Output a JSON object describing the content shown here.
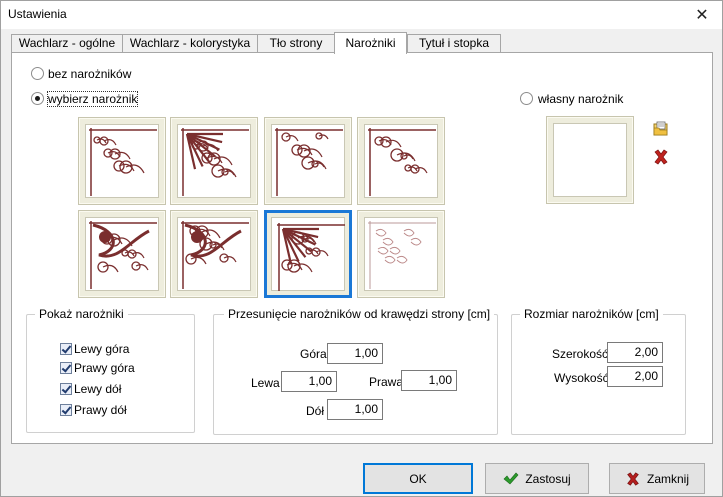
{
  "window": {
    "title": "Ustawienia"
  },
  "tabs": [
    {
      "label": "Wachlarz - ogólne"
    },
    {
      "label": "Wachlarz - kolorystyka"
    },
    {
      "label": "Tło strony"
    },
    {
      "label": "Narożniki"
    },
    {
      "label": "Tytuł i stopka"
    }
  ],
  "active_tab": "Narożniki",
  "corner_mode": {
    "none_label": "bez narożników",
    "choose_label": "wybierz narożnik",
    "custom_label": "własny narożnik",
    "selected": "wybierz narożnik"
  },
  "corner_thumbnails": {
    "count": 8,
    "selected_index": 6,
    "ornament_color": "#7a2e2e"
  },
  "custom_corner": {
    "load_icon": "folder-load-icon",
    "delete_icon": "red-x-delete-icon"
  },
  "show_corners": {
    "title": "Pokaż narożniki",
    "items": [
      {
        "label": "Lewy góra",
        "checked": true
      },
      {
        "label": "Prawy góra",
        "checked": true
      },
      {
        "label": "Lewy dół",
        "checked": true
      },
      {
        "label": "Prawy dół",
        "checked": true
      }
    ]
  },
  "offset": {
    "title": "Przesunięcie narożników od krawędzi strony  [cm]",
    "top_label": "Góra",
    "top_value": "1,00",
    "left_label": "Lewa",
    "left_value": "1,00",
    "right_label": "Prawa",
    "right_value": "1,00",
    "bottom_label": "Dół",
    "bottom_value": "1,00"
  },
  "size": {
    "title": "Rozmiar narożników [cm]",
    "width_label": "Szerokość",
    "width_value": "2,00",
    "height_label": "Wysokość",
    "height_value": "2,00"
  },
  "footer": {
    "ok_label": "OK",
    "apply_label": "Zastosuj",
    "close_label": "Zamknij"
  },
  "colors": {
    "accent": "#0078d7",
    "check_green": "#2c9a2c",
    "close_red": "#b41e1e"
  }
}
